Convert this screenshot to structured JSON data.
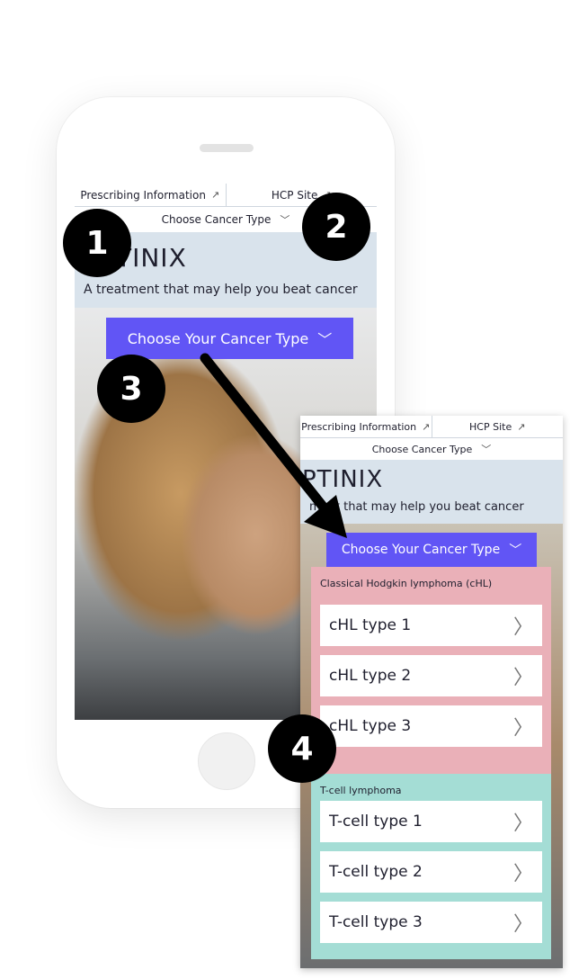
{
  "phone": {
    "topbar": {
      "prescribing": "Prescribing Information",
      "hcp": "HCP Site",
      "ext_icon": "↗"
    },
    "choose_cancer_type": "Choose Cancer Type",
    "brand": "TINIX",
    "tagline": "A treatment that may help you beat cancer",
    "cta": "Choose Your Cancer Type"
  },
  "panel": {
    "topbar": {
      "prescribing": "Prescribing Information",
      "hcp": "HCP Site",
      "ext_icon": "↗"
    },
    "choose_cancer_type": "Choose Cancer Type",
    "brand": "PTINIX",
    "tagline": "A treatment that may help you beat cancer",
    "tagline_visible": "ment that may help you beat cancer",
    "cta": "Choose Your Cancer Type",
    "groups": [
      {
        "title": "Classical Hodgkin lymphoma (cHL)",
        "items": [
          "cHL type 1",
          "cHL type 2",
          "cHL type 3"
        ]
      },
      {
        "title": "T-cell lymphoma",
        "items": [
          "T-cell type 1",
          "T-cell type 2",
          "T-cell type 3"
        ]
      }
    ]
  },
  "badges": [
    "1",
    "2",
    "3",
    "4"
  ],
  "chevrons": {
    "down": "﹀",
    "right": "〉"
  },
  "colors": {
    "cta": "#6155f5",
    "group_pink": "#eab0b8",
    "group_teal": "#a4ddd5",
    "screen_bg": "#d9e3ec"
  }
}
